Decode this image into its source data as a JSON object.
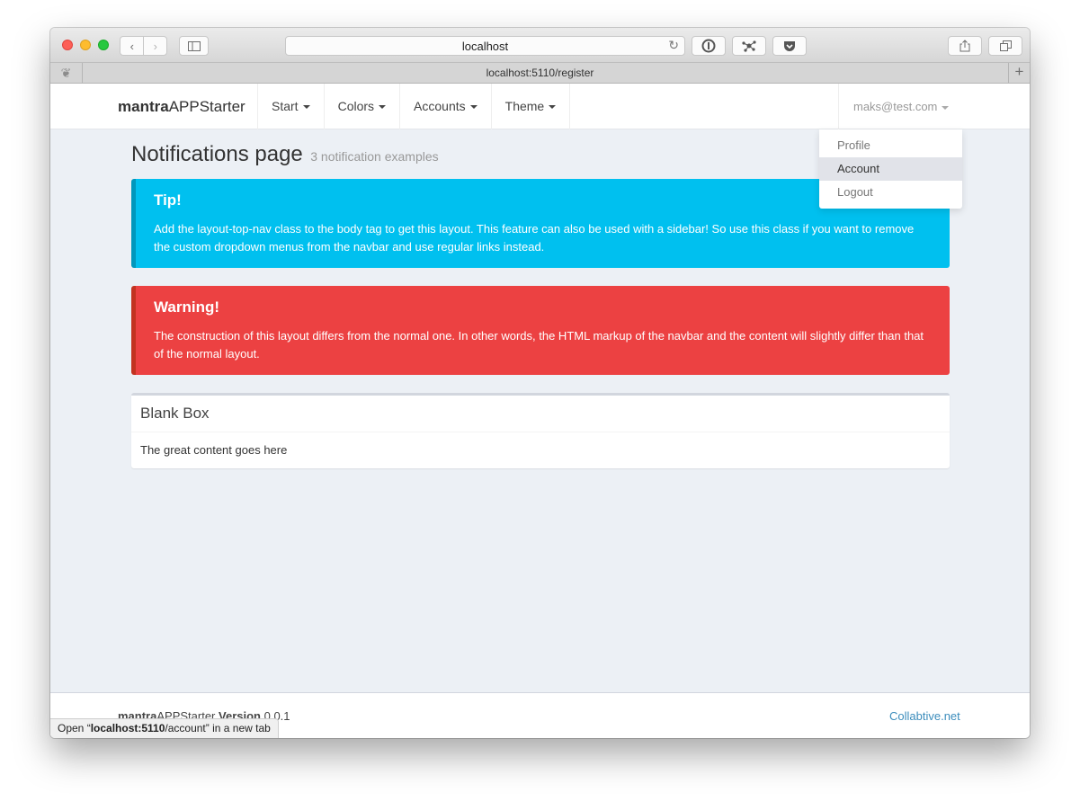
{
  "browser": {
    "address": "localhost",
    "tab_url": "localhost:5110/register",
    "status_tip_prefix": "Open “",
    "status_tip_url_host": "localhost:5110",
    "status_tip_url_path": "/account",
    "status_tip_suffix": "” in a new tab"
  },
  "navbar": {
    "brand_bold": "mantra",
    "brand_rest": "APPStarter",
    "items": [
      {
        "label": "Start"
      },
      {
        "label": "Colors"
      },
      {
        "label": "Accounts"
      },
      {
        "label": "Theme"
      }
    ],
    "user": "maks@test.com"
  },
  "user_dropdown": {
    "items": [
      {
        "label": "Profile"
      },
      {
        "label": "Account"
      },
      {
        "label": "Logout"
      }
    ]
  },
  "page": {
    "title": "Notifications page",
    "subtitle": "3 notification examples"
  },
  "callouts": {
    "tip": {
      "title": "Tip!",
      "text": "Add the layout-top-nav class to the body tag to get this layout. This feature can also be used with a sidebar! So use this class if you want to remove the custom dropdown menus from the navbar and use regular links instead.",
      "color": "#00c0ef"
    },
    "warning": {
      "title": "Warning!",
      "text": "The construction of this layout differs from the normal one. In other words, the HTML markup of the navbar and the content will slightly differ than that of the normal layout.",
      "color": "#ec4142"
    }
  },
  "box": {
    "title": "Blank Box",
    "body": "The great content goes here"
  },
  "footer": {
    "brand_bold": "mantra",
    "brand_rest": "APPStarter",
    "version_label": "Version",
    "version": "0.0.1",
    "link": "Collabtive.net"
  }
}
